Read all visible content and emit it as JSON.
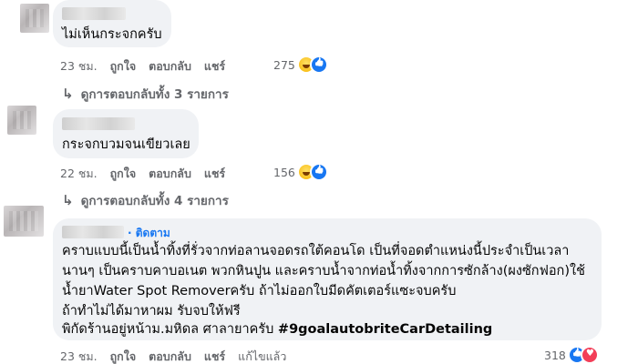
{
  "comments": [
    {
      "text_lines": [
        "ไม่เห็นกระจกครับ"
      ],
      "time": "23 ชม.",
      "like_label": "ถูกใจ",
      "reply_label": "ตอบกลับ",
      "share_label": "แชร์",
      "reaction_count": "275",
      "reactions": [
        "haha-icon",
        "like-icon"
      ],
      "view_replies": "ดูการตอบกลับทั้ง 3 รายการ"
    },
    {
      "text_lines": [
        "กระจกบวมจนเขียวเลย"
      ],
      "time": "22 ชม.",
      "like_label": "ถูกใจ",
      "reply_label": "ตอบกลับ",
      "share_label": "แชร์",
      "reaction_count": "156",
      "reactions": [
        "haha-icon",
        "like-icon"
      ],
      "view_replies": "ดูการตอบกลับทั้ง 4 รายการ"
    },
    {
      "follow_label": "· ติดตาม",
      "text_lines": [
        "คราบแบบนี้เป็นน้ำทิ้งที่รั่วจากท่อลานจอดรถใต้คอนโด เป็นที่จอดตำแหน่งนี้ประจำเป็นเวลา",
        "นานๆ เป็นคราบคาบอเนต พวกหินปูน และคราบน้ำจากท่อน้ำทิ้งจากการซักล้าง(ผงซักฟอก)ใช้",
        "น้ำยาWater Spot Removerครับ ถ้าไม่ออกใบมีดคัตเตอร์แซะจบครับ",
        "ถ้าทำไม่ได้มาหาผม รับจบให้ฟรี",
        "พิกัดร้านอยู่หน้าม.มหิดล ศาลายาครับ"
      ],
      "hashtag": "#9goalautobriteCarDetailing",
      "time": "23 ชม.",
      "like_label": "ถูกใจ",
      "reply_label": "ตอบกลับ",
      "share_label": "แชร์",
      "edited_label": "แก้ไขแล้ว",
      "reaction_count": "318",
      "reactions": [
        "like-icon",
        "love-icon"
      ]
    }
  ]
}
